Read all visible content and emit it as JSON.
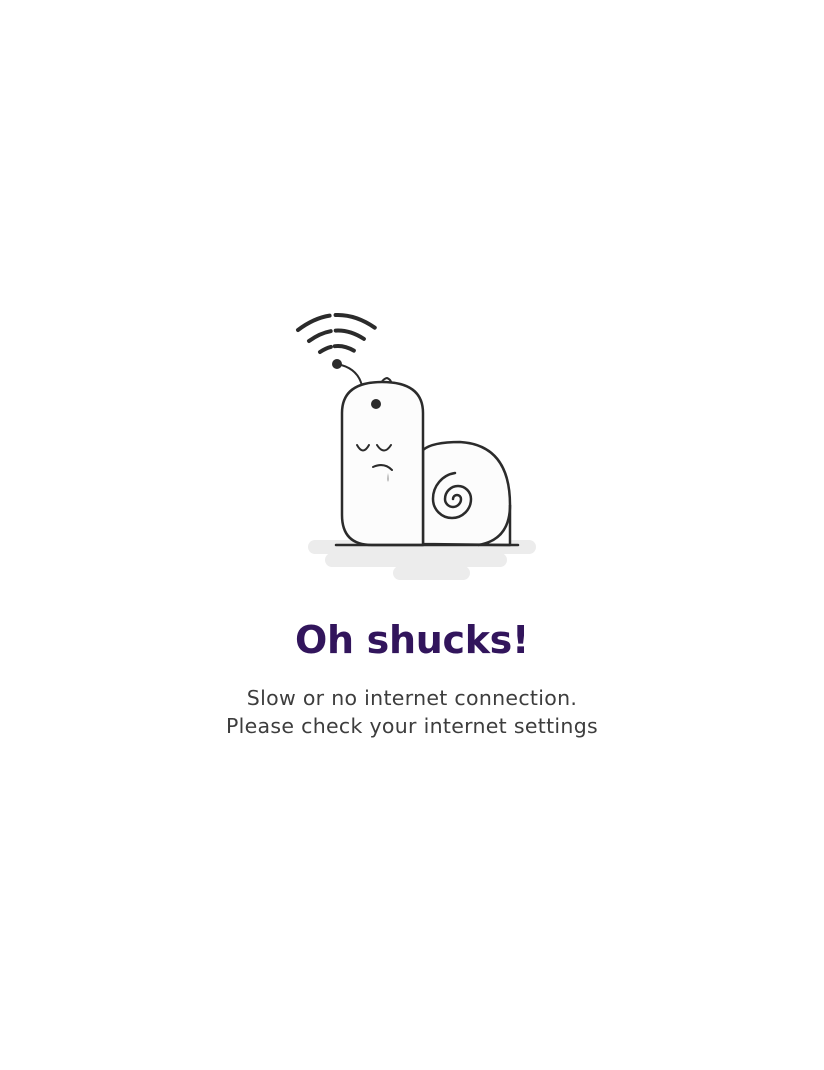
{
  "error_state": {
    "illustration": {
      "icon": "sad-snail-wifi-icon",
      "colors": {
        "stroke": "#2b2b2b",
        "fill": "#fcfcfc",
        "shadow": "#ececec"
      }
    },
    "title": "Oh shucks!",
    "message_line_1": "Slow or no internet connection.",
    "message_line_2": "Please check your internet settings",
    "colors": {
      "title": "#32155c",
      "message": "#3d3d3d"
    }
  }
}
